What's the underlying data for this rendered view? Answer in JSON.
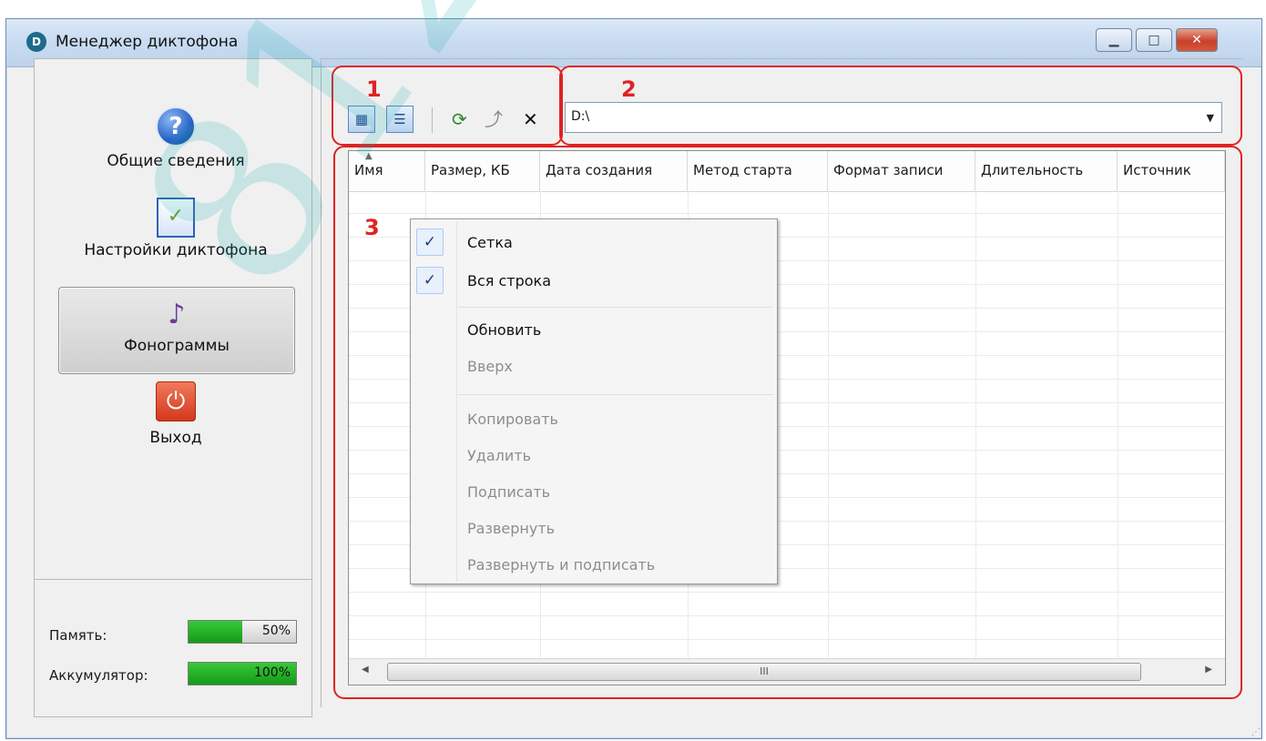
{
  "window": {
    "title": "Менеджер диктофона",
    "controls": {
      "minimize": "▁",
      "maximize": "□",
      "close": "✕"
    }
  },
  "sidebar": {
    "items": [
      {
        "label": "Общие сведения",
        "icon": "help-icon",
        "selected": false
      },
      {
        "label": "Настройки диктофона",
        "icon": "settings-icon",
        "selected": false
      },
      {
        "label": "Фонограммы",
        "icon": "sound-icon",
        "selected": true
      },
      {
        "label": "Выход",
        "icon": "exit-icon",
        "selected": false
      }
    ]
  },
  "status": {
    "memory_label": "Память:",
    "memory_value": "50%",
    "memory_fraction": 0.5,
    "battery_label": "Аккумулятор:",
    "battery_value": "100%",
    "battery_fraction": 1.0
  },
  "toolbar": {
    "grid_view_icon": "grid-view-icon",
    "full_row_icon": "full-row-icon",
    "refresh_icon": "refresh-icon",
    "up_icon": "up-icon",
    "delete_icon": "delete-icon",
    "path_value": "D:\\"
  },
  "grid": {
    "columns": [
      "Имя",
      "Размер, КБ",
      "Дата создания",
      "Метод старта",
      "Формат записи",
      "Длительность",
      "Источник"
    ],
    "scroll_label": "III"
  },
  "context_menu": {
    "items": [
      {
        "label": "Сетка",
        "checked": true,
        "enabled": true
      },
      {
        "label": "Вся строка",
        "checked": true,
        "enabled": true
      },
      {
        "label": "Обновить",
        "checked": false,
        "enabled": true
      },
      {
        "label": "Вверх",
        "checked": false,
        "enabled": false
      },
      {
        "label": "Копировать",
        "checked": false,
        "enabled": false
      },
      {
        "label": "Удалить",
        "checked": false,
        "enabled": false
      },
      {
        "label": "Подписать",
        "checked": false,
        "enabled": false
      },
      {
        "label": "Развернуть",
        "checked": false,
        "enabled": false
      },
      {
        "label": "Развернуть и подписать",
        "checked": false,
        "enabled": false
      }
    ],
    "check_mark": "✓"
  },
  "annotations": {
    "n1": "1",
    "n2": "2",
    "n3": "3"
  },
  "watermark": "812.com",
  "colors": {
    "annotation": "#e02222",
    "watermark": "#16aaaa",
    "progress": "#22b024"
  }
}
